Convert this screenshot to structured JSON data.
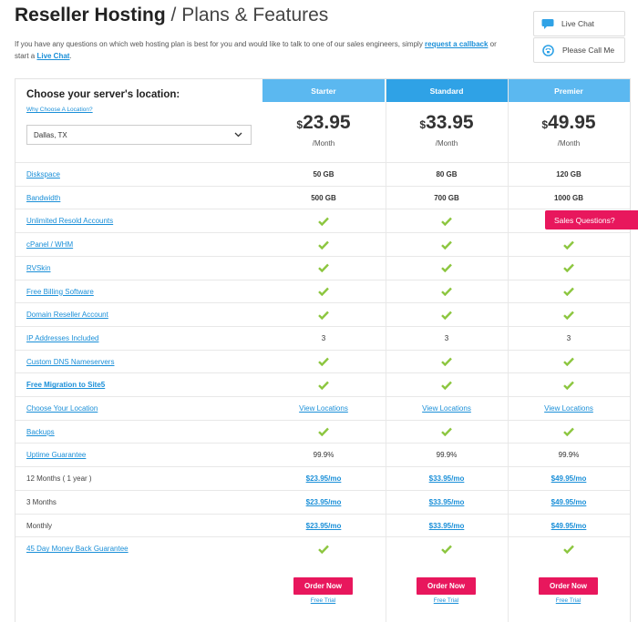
{
  "header": {
    "title_bold": "Reseller Hosting",
    "title_rest": " / Plans & Features",
    "intro_text": "If you have any questions on which web hosting plan is best for you and would like to talk to one of our sales engineers, simply ",
    "intro_link1": "request a callback",
    "intro_mid": " or start a ",
    "intro_link2": "Live Chat",
    "intro_end": "."
  },
  "side_buttons": {
    "live_chat": "Live Chat",
    "call_me": "Please Call Me"
  },
  "location": {
    "title": "Choose your server's location:",
    "why_link": "Why Choose A Location?",
    "selected": "Dallas, TX"
  },
  "plans": [
    {
      "name": "Starter",
      "dollar": "$",
      "price": "23.95",
      "per": "/Month",
      "color": "#5bb8f0"
    },
    {
      "name": "Standard",
      "dollar": "$",
      "price": "33.95",
      "per": "/Month",
      "color": "#2fa2e6"
    },
    {
      "name": "Premier",
      "dollar": "$",
      "price": "49.95",
      "per": "/Month",
      "color": "#5bb8f0"
    }
  ],
  "features": [
    {
      "label": "Diskspace",
      "values": [
        "50 GB",
        "80 GB",
        "120 GB"
      ]
    },
    {
      "label": "Bandwidth",
      "values": [
        "500 GB",
        "700 GB",
        "1000 GB"
      ]
    },
    {
      "label": "Unlimited Resold Accounts"
    },
    {
      "label": "cPanel / WHM"
    },
    {
      "label": "RVSkin"
    },
    {
      "label": "Free Billing Software"
    },
    {
      "label": "Domain Reseller Account"
    },
    {
      "label": "IP Addresses Included",
      "values": [
        "3",
        "3",
        "3"
      ]
    },
    {
      "label": "Custom DNS Nameservers"
    },
    {
      "label": "Free Migration to Site5"
    },
    {
      "label": "Choose Your Location",
      "values": [
        "View Locations",
        "View Locations",
        "View Locations"
      ]
    },
    {
      "label": "Backups"
    },
    {
      "label": "Uptime Guarantee",
      "values": [
        "99.9%",
        "99.9%",
        "99.9%"
      ]
    },
    {
      "label": "12 Months ( 1 year )",
      "values": [
        "$23.95/mo",
        "$33.95/mo",
        "$49.95/mo"
      ]
    },
    {
      "label": "3 Months",
      "values": [
        "$23.95/mo",
        "$33.95/mo",
        "$49.95/mo"
      ]
    },
    {
      "label": "Monthly",
      "values": [
        "$23.95/mo",
        "$33.95/mo",
        "$49.95/mo"
      ]
    },
    {
      "label": "45 Day Money Back Guarantee"
    }
  ],
  "actions": {
    "order_now": "Order Now",
    "free_trial": "Free Trial"
  },
  "sales_tab": "Sales Questions?",
  "colors": {
    "accent_blue": "#1a8fd8",
    "check_green": "#8cc63f",
    "cta_pink": "#e8175d"
  },
  "icons": {
    "live_chat": "chat-bubble-icon",
    "call_me": "phone-icon",
    "check": "checkmark-icon",
    "select": "chevron-down-icon"
  }
}
